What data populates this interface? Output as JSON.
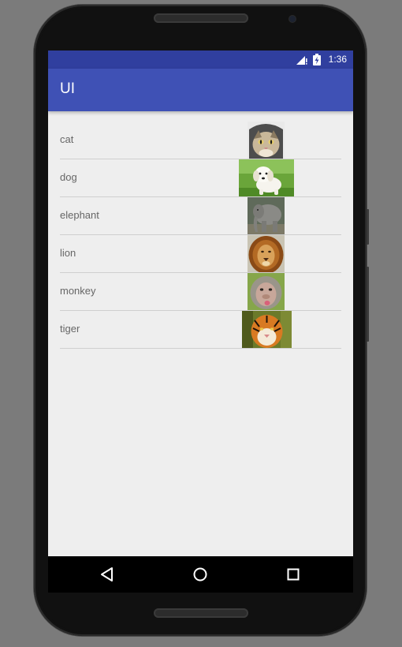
{
  "status_bar": {
    "time": "1:36"
  },
  "app_bar": {
    "title": "UI"
  },
  "animals": [
    {
      "label": "cat",
      "image": "cat-photo"
    },
    {
      "label": "dog",
      "image": "dog-photo"
    },
    {
      "label": "elephant",
      "image": "elephant-photo"
    },
    {
      "label": "lion",
      "image": "lion-photo"
    },
    {
      "label": "monkey",
      "image": "monkey-photo"
    },
    {
      "label": "tiger",
      "image": "tiger-photo"
    }
  ],
  "nav_bar": {
    "buttons": [
      "back-icon",
      "home-icon",
      "recents-icon"
    ]
  },
  "colors": {
    "primary": "#3f51b5",
    "primary_dark": "#303f9f",
    "background": "#eeeeee"
  }
}
